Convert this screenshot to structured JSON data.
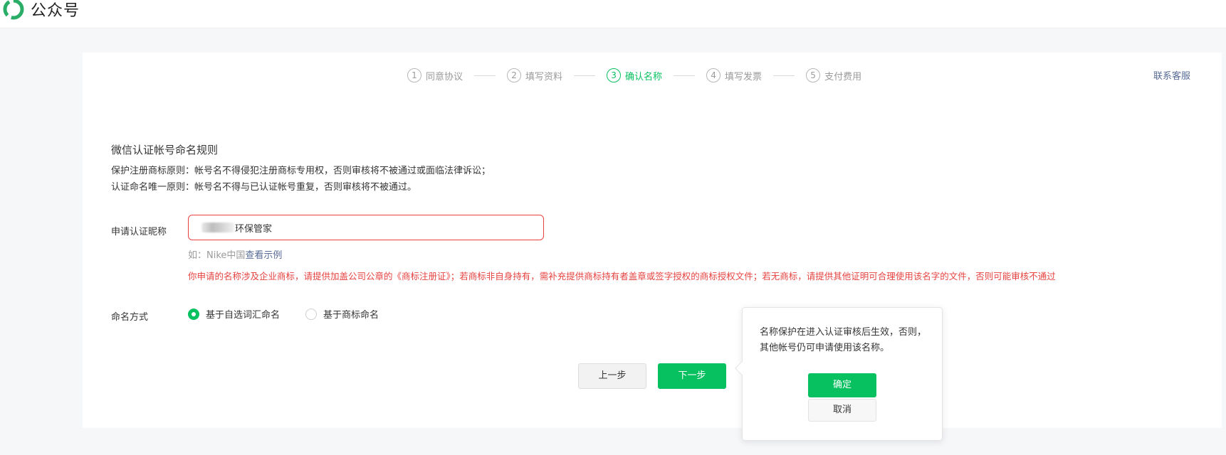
{
  "header": {
    "app_title": "公众号",
    "logo_icon": "wechat-official-account-logo-icon"
  },
  "steps": [
    {
      "num": "1",
      "label": "同意协议",
      "active": false
    },
    {
      "num": "2",
      "label": "填写资料",
      "active": false
    },
    {
      "num": "3",
      "label": "确认名称",
      "active": true
    },
    {
      "num": "4",
      "label": "填写发票",
      "active": false
    },
    {
      "num": "5",
      "label": "支付费用",
      "active": false
    }
  ],
  "contact_link": "联系客服",
  "rules": {
    "title": "微信认证帐号命名规则",
    "items": [
      "保护注册商标原则：帐号名不得侵犯注册商标专用权，否则审核将不被通过或面临法律诉讼；",
      "认证命名唯一原则：帐号名不得与已认证帐号重复，否则审核将不被通过。"
    ]
  },
  "nickname": {
    "label": "申请认证昵称",
    "value": "环保管家",
    "hint_prefix": "如：Nike中国",
    "hint_link": "查看示例",
    "error": "你申请的名称涉及企业商标，请提供加盖公司公章的《商标注册证》；若商标非自身持有，需补充提供商标持有者盖章或签字授权的商标授权文件；若无商标，请提供其他证明可合理使用该名字的文件，否则可能审核不通过"
  },
  "naming": {
    "label": "命名方式",
    "options": [
      {
        "label": "基于自选词汇命名",
        "checked": true
      },
      {
        "label": "基于商标命名",
        "checked": false
      }
    ]
  },
  "buttons": {
    "prev": "上一步",
    "next": "下一步"
  },
  "popover": {
    "text": "名称保护在进入认证审核后生效，否则，其他帐号仍可申请使用该名称。",
    "confirm": "确定",
    "cancel": "取消"
  },
  "colors": {
    "accent": "#07c160",
    "error": "#e64340",
    "link": "#576b95"
  }
}
